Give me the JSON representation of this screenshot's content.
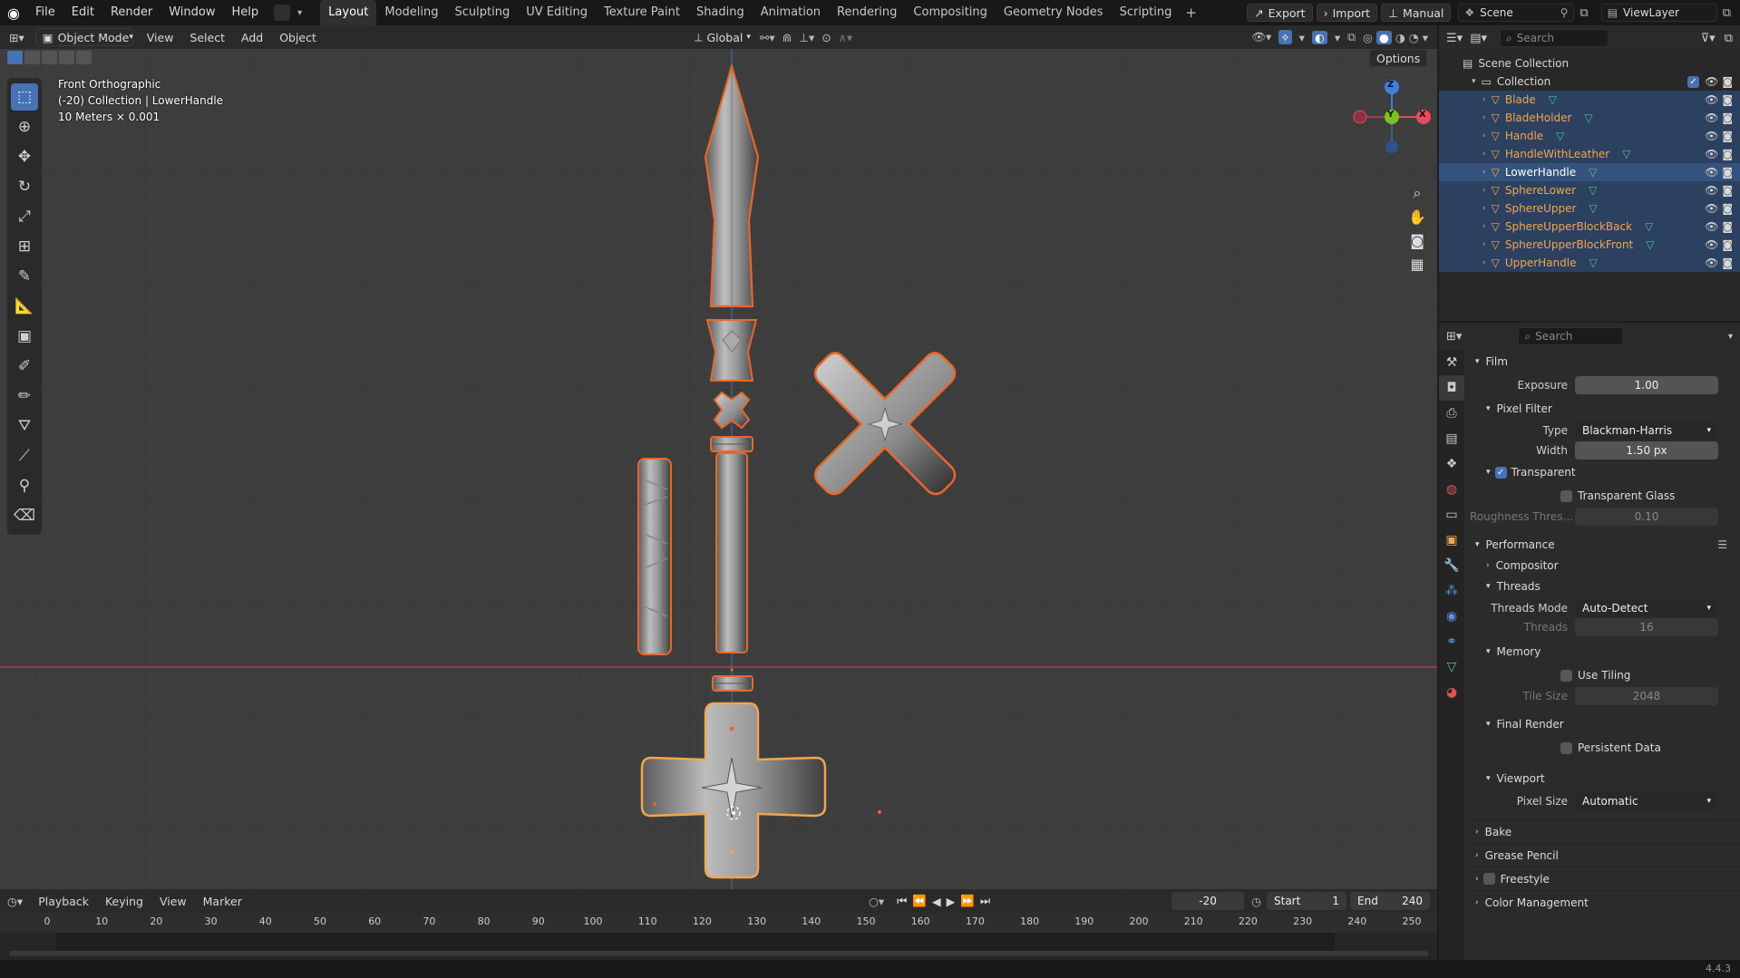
{
  "topbar": {
    "menus": [
      "File",
      "Edit",
      "Render",
      "Window",
      "Help"
    ],
    "workspaces": [
      "Layout",
      "Modeling",
      "Sculpting",
      "UV Editing",
      "Texture Paint",
      "Shading",
      "Animation",
      "Rendering",
      "Compositing",
      "Geometry Nodes",
      "Scripting"
    ],
    "active_workspace": "Layout",
    "plus": "+",
    "export_label": "Export",
    "import_label": "Import",
    "manual_label": "Manual",
    "scene_name": "Scene",
    "view_layer": "ViewLayer"
  },
  "viewport_header": {
    "mode": "Object Mode",
    "menus": [
      "View",
      "Select",
      "Add",
      "Object"
    ],
    "transform_orientation": "Global",
    "options_label": "Options"
  },
  "viewport": {
    "view_name": "Front Orthographic",
    "collection_info": "(-20) Collection | LowerHandle",
    "scale_info": "10 Meters × 0.001",
    "gizmo_axes": [
      "Z",
      "Y",
      "X"
    ]
  },
  "outliner": {
    "search_placeholder": "Search",
    "scene_collection": "Scene Collection",
    "collection": "Collection",
    "objects": [
      "Blade",
      "BladeHolder",
      "Handle",
      "HandleWithLeather",
      "LowerHandle",
      "SphereLower",
      "SphereUpper",
      "SphereUpperBlockBack",
      "SphereUpperBlockFront",
      "UpperHandle"
    ],
    "active_object": "LowerHandle"
  },
  "properties": {
    "search_placeholder": "Search",
    "film_label": "Film",
    "exposure_label": "Exposure",
    "exposure_value": "1.00",
    "pixel_filter_label": "Pixel Filter",
    "type_label": "Type",
    "type_value": "Blackman-Harris",
    "width_label": "Width",
    "width_value": "1.50 px",
    "transparent_label": "Transparent",
    "transparent_glass_label": "Transparent Glass",
    "roughness_label": "Roughness Thres...",
    "roughness_value": "0.10",
    "performance_label": "Performance",
    "compositor_label": "Compositor",
    "threads_label": "Threads",
    "threads_mode_label": "Threads Mode",
    "threads_mode_value": "Auto-Detect",
    "threads_count_label": "Threads",
    "threads_count_value": "16",
    "memory_label": "Memory",
    "use_tiling_label": "Use Tiling",
    "tile_size_label": "Tile Size",
    "tile_size_value": "2048",
    "final_render_label": "Final Render",
    "persistent_data_label": "Persistent Data",
    "viewport_label": "Viewport",
    "pixel_size_label": "Pixel Size",
    "pixel_size_value": "Automatic",
    "bake_label": "Bake",
    "grease_pencil_label": "Grease Pencil",
    "freestyle_label": "Freestyle",
    "color_management_label": "Color Management"
  },
  "timeline": {
    "menus": [
      "Playback",
      "Keying",
      "View",
      "Marker"
    ],
    "current_frame": "-20",
    "start_label": "Start",
    "start_value": "1",
    "end_label": "End",
    "end_value": "240",
    "ruler": [
      "0",
      "10",
      "20",
      "30",
      "40",
      "50",
      "60",
      "70",
      "80",
      "90",
      "100",
      "110",
      "120",
      "130",
      "140",
      "150",
      "160",
      "170",
      "180",
      "190",
      "200",
      "210",
      "220",
      "230",
      "240",
      "250"
    ]
  },
  "status": {
    "version": "4.4.3"
  },
  "colors": {
    "selection_orange": "#f0a64e",
    "outline_orange": "#e8682b",
    "accent_blue": "#4772b3",
    "x_axis": "#e84a5f",
    "y_axis": "#7fbf1f",
    "z_axis": "#3f7fe0"
  }
}
